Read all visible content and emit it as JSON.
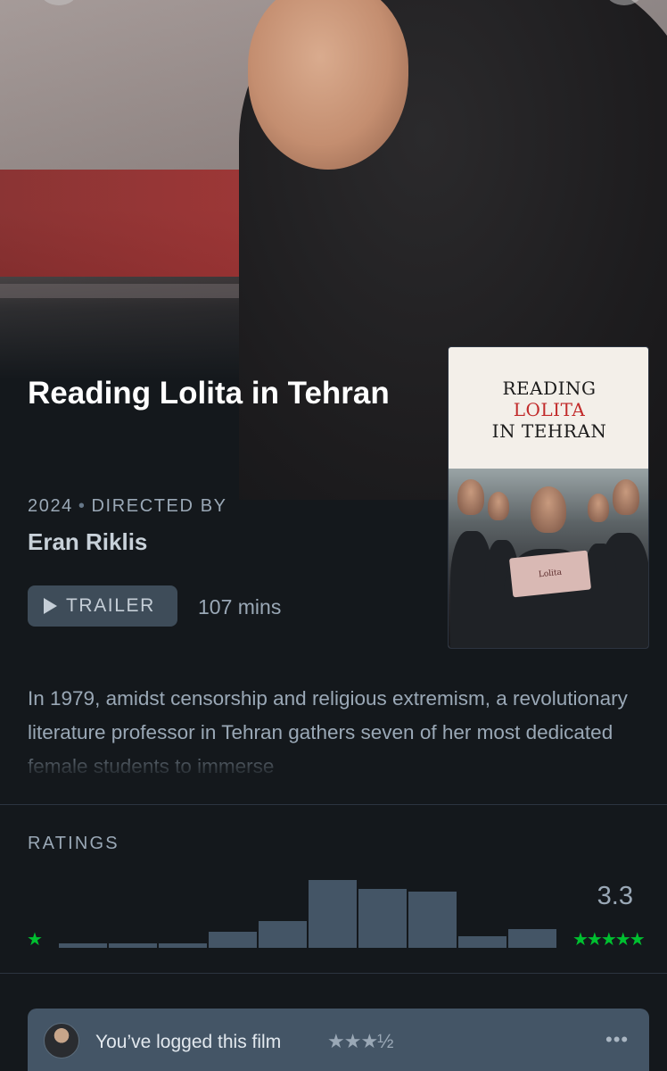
{
  "film": {
    "title": "Reading Lolita in Tehran",
    "year": "2024",
    "directed_by_label": "DIRECTED BY",
    "director": "Eran Riklis",
    "trailer_label": "TRAILER",
    "runtime": "107 mins",
    "synopsis": "In 1979, amidst censorship and religious extremism, a revolutionary literature professor in Tehran gathers seven of her most dedicated female students to immerse"
  },
  "poster": {
    "line1": "READING",
    "line2": "LOLITA",
    "line3": "IN TEHRAN",
    "book_text": "Lolita"
  },
  "ratings": {
    "label": "RATINGS",
    "average": "3.3",
    "min_stars": "★",
    "max_stars": "★★★★★",
    "chart_data": {
      "type": "bar",
      "categories": [
        "½",
        "1",
        "1½",
        "2",
        "2½",
        "3",
        "3½",
        "4",
        "4½",
        "5"
      ],
      "values": [
        6,
        6,
        6,
        22,
        36,
        92,
        80,
        76,
        16,
        26
      ],
      "ylim": [
        0,
        92
      ]
    }
  },
  "log": {
    "text": "You’ve logged this film",
    "stars": "★★★½",
    "more_icon": "more-dots-icon",
    "more_glyph": "•••"
  },
  "colors": {
    "background": "#14181c",
    "accent_green": "#00c030",
    "bar": "#445566",
    "muted_text": "#9aa8b6"
  }
}
